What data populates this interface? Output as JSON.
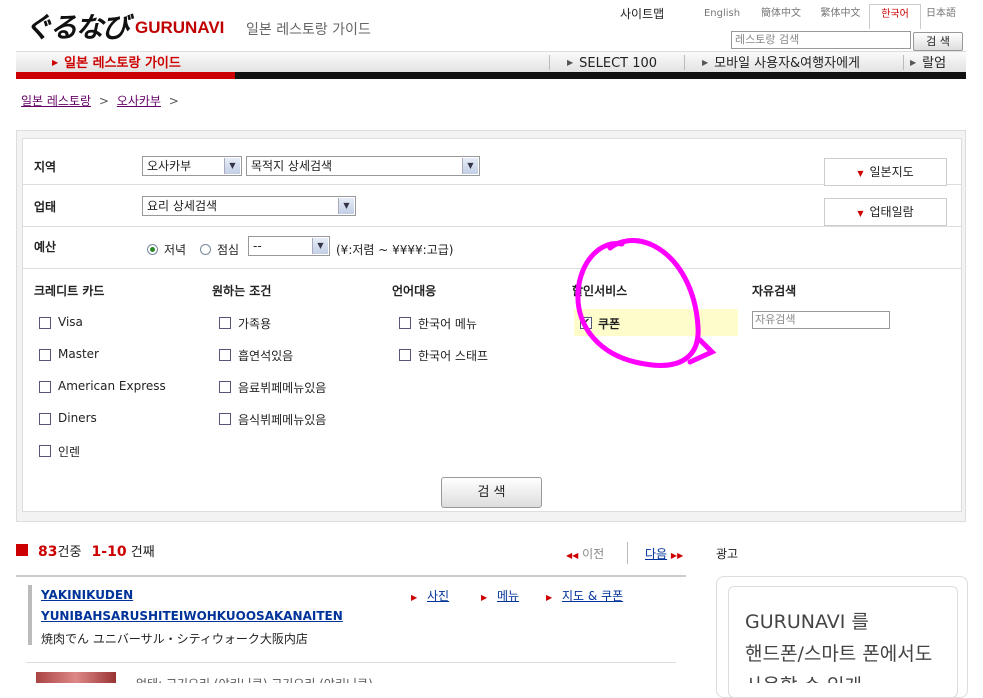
{
  "header": {
    "logo_jp": "ぐるなび",
    "logo_en": "GURUNAVI",
    "tagline": "일본 레스토랑 가이드",
    "sitemap": "사이트맵",
    "languages": [
      "English",
      "簡体中文",
      "繁体中文",
      "한국어",
      "日本語"
    ],
    "search_placeholder": "레스토랑 검색",
    "search_button": "검 색"
  },
  "nav": {
    "items": [
      "일본 레스토랑 가이드",
      "SELECT 100",
      "모바일 사용자&여행자에게",
      "랄엄"
    ]
  },
  "breadcrumb": [
    "일본 레스토랑",
    "오사카부"
  ],
  "form": {
    "region_label": "지역",
    "region_value": "오사카부",
    "destination_value": "목적지 상세검색",
    "japan_map_button": "일본지도",
    "category_label": "업태",
    "category_value": "요리 상세검색",
    "category_list_button": "업태일람",
    "budget_label": "예산",
    "dinner_label": "저녁",
    "lunch_label": "점심",
    "budget_value": "--",
    "budget_hint": "(¥:저렴 ~ ¥¥¥¥:고급)",
    "columns": [
      {
        "title": "크레디트 카드",
        "options": [
          "Visa",
          "Master",
          "American Express",
          "Diners",
          "인렌"
        ]
      },
      {
        "title": "원하는 조건",
        "options": [
          "가족용",
          "흡연석있음",
          "음료뷔페메뉴있음",
          "음식뷔페메뉴있음"
        ]
      },
      {
        "title": "언어대응",
        "options": [
          "한국어 메뉴",
          "한국어 스태프"
        ]
      },
      {
        "title": "할인서비스",
        "options": [
          "쿠폰"
        ]
      }
    ],
    "free_search_title": "자유검색",
    "free_search_placeholder": "자유검색",
    "search_button": "검 색"
  },
  "results": {
    "count": "83",
    "count_suffix": "건중",
    "range": "1-10",
    "range_suffix": "건째",
    "prev": "이전",
    "next": "다음",
    "ad_label": "광고",
    "items": [
      {
        "name_line1": "YAKINIKUDEN",
        "name_line2": "YUNIBAHSARUSHITEIWOHKUOOSAKANAITEN",
        "name_jp": "焼肉でん ユニバーサル・シティウォーク大阪内店",
        "links": [
          "사진",
          "메뉴",
          "지도 & 쿠폰"
        ]
      }
    ],
    "next_item_partial": "업태: 고기요리 (야키니쿠) 고기요리 (야키니쿠)"
  },
  "ad": {
    "line1": "GURUNAVI 를",
    "line2": "핸드폰/스마트 폰에서도",
    "line3": "사용할 수 있게"
  },
  "colors": {
    "accent": "#c00000",
    "link": "#003399",
    "highlight_circle": "#ff00ff",
    "coupon_bg": "#fffccc"
  }
}
